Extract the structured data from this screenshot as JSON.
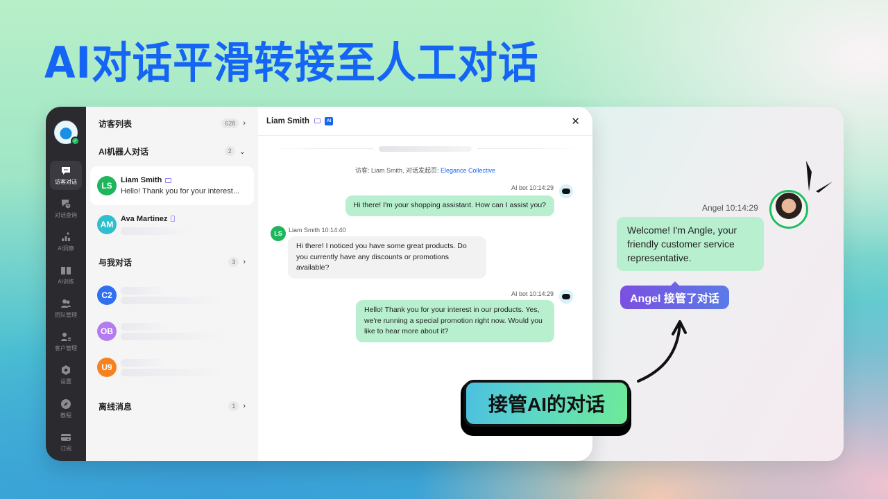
{
  "hero": {
    "title": "AI对话平滑转接至人工对话"
  },
  "nav": {
    "items": [
      {
        "label": "访客对话",
        "icon": "chat-bubble-icon",
        "active": true
      },
      {
        "label": "对话查询",
        "icon": "chat-history-icon"
      },
      {
        "label": "AI洞察",
        "icon": "insights-icon"
      },
      {
        "label": "AI训练",
        "icon": "book-icon"
      },
      {
        "label": "团队管理",
        "icon": "team-icon"
      },
      {
        "label": "客户管理",
        "icon": "customer-icon"
      },
      {
        "label": "设置",
        "icon": "settings-icon"
      }
    ],
    "bottom": [
      {
        "label": "教程",
        "icon": "compass-icon"
      },
      {
        "label": "订阅",
        "icon": "card-icon"
      }
    ]
  },
  "list": {
    "visitors": {
      "title": "访客列表",
      "count": "628"
    },
    "ai_chats": {
      "title": "AI机器人对话",
      "count": "2"
    },
    "conversations": [
      {
        "initials": "LS",
        "name": "Liam Smith",
        "preview": "Hello! Thank you for your interest...",
        "color": "#1fb55a",
        "device": "desktop"
      },
      {
        "initials": "AM",
        "name": "Ava Martinez",
        "preview": "",
        "color": "#2fbfcc",
        "device": "mobile"
      }
    ],
    "my_chats": {
      "title": "与我对话",
      "count": "3"
    },
    "my_conversations": [
      {
        "initials": "C2",
        "color": "#2f6ff0"
      },
      {
        "initials": "OB",
        "color": "#b47cf0"
      },
      {
        "initials": "U9",
        "color": "#f5821f"
      }
    ],
    "offline": {
      "title": "离线消息",
      "count": "1"
    }
  },
  "chat": {
    "title": "Liam Smith",
    "ai_badge": "AI",
    "system_prefix": "访客: Liam Smith, 对话发起页: ",
    "system_link": "Elegance Collective",
    "messages": [
      {
        "sender": "AI bot",
        "time": "10:14:29",
        "meta": "AI bot 10:14:29",
        "text": "Hi there! I'm your shopping assistant. How can I assist you?"
      },
      {
        "sender": "Liam Smith",
        "time": "10:14:40",
        "meta": "Liam Smith 10:14:40",
        "text": "Hi there! I noticed you have some great products. Do you currently have any discounts or promotions available?"
      },
      {
        "sender": "AI bot",
        "time": "10:14:29",
        "meta": "AI bot 10:14:29",
        "text": "Hello! Thank you for your interest in our products. Yes, we're running a special promotion right now. Would you like to hear more about it?"
      }
    ]
  },
  "callout": {
    "agent_meta": "Angel 10:14:29",
    "agent_message": "Welcome! I'm Angle, your friendly customer service representative.",
    "takeover_notice": "Angel 接管了对话",
    "takeover_button": "接管AI的对话"
  }
}
